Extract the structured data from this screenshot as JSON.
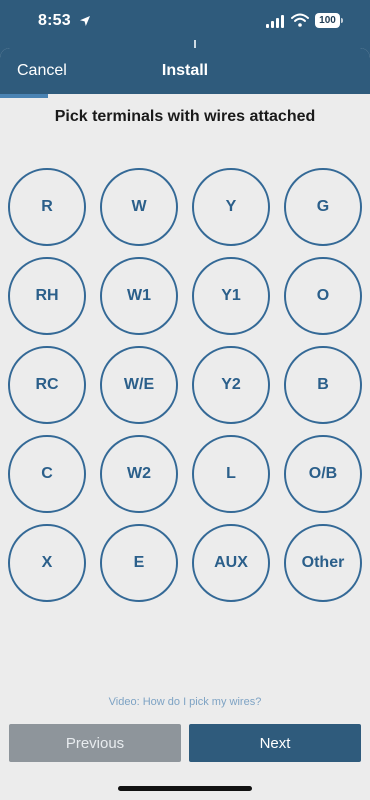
{
  "status_bar": {
    "time": "8:53",
    "battery": "100",
    "icons": [
      "location-arrow-icon",
      "signal-icon",
      "wifi-icon",
      "battery-icon"
    ]
  },
  "nav": {
    "cancel_label": "Cancel",
    "title": "Install"
  },
  "progress": {
    "fraction": 0.13
  },
  "heading": "Pick terminals with wires attached",
  "terminals": [
    "R",
    "W",
    "Y",
    "G",
    "RH",
    "W1",
    "Y1",
    "O",
    "RC",
    "W/E",
    "Y2",
    "B",
    "C",
    "W2",
    "L",
    "O/B",
    "X",
    "E",
    "AUX",
    "Other"
  ],
  "video_link": "Video: How do I pick my wires?",
  "buttons": {
    "previous": "Previous",
    "next": "Next"
  },
  "colors": {
    "brand": "#2f5b7c",
    "terminal_border": "#346996",
    "background": "#ececec",
    "previous_button": "#8e959b"
  }
}
